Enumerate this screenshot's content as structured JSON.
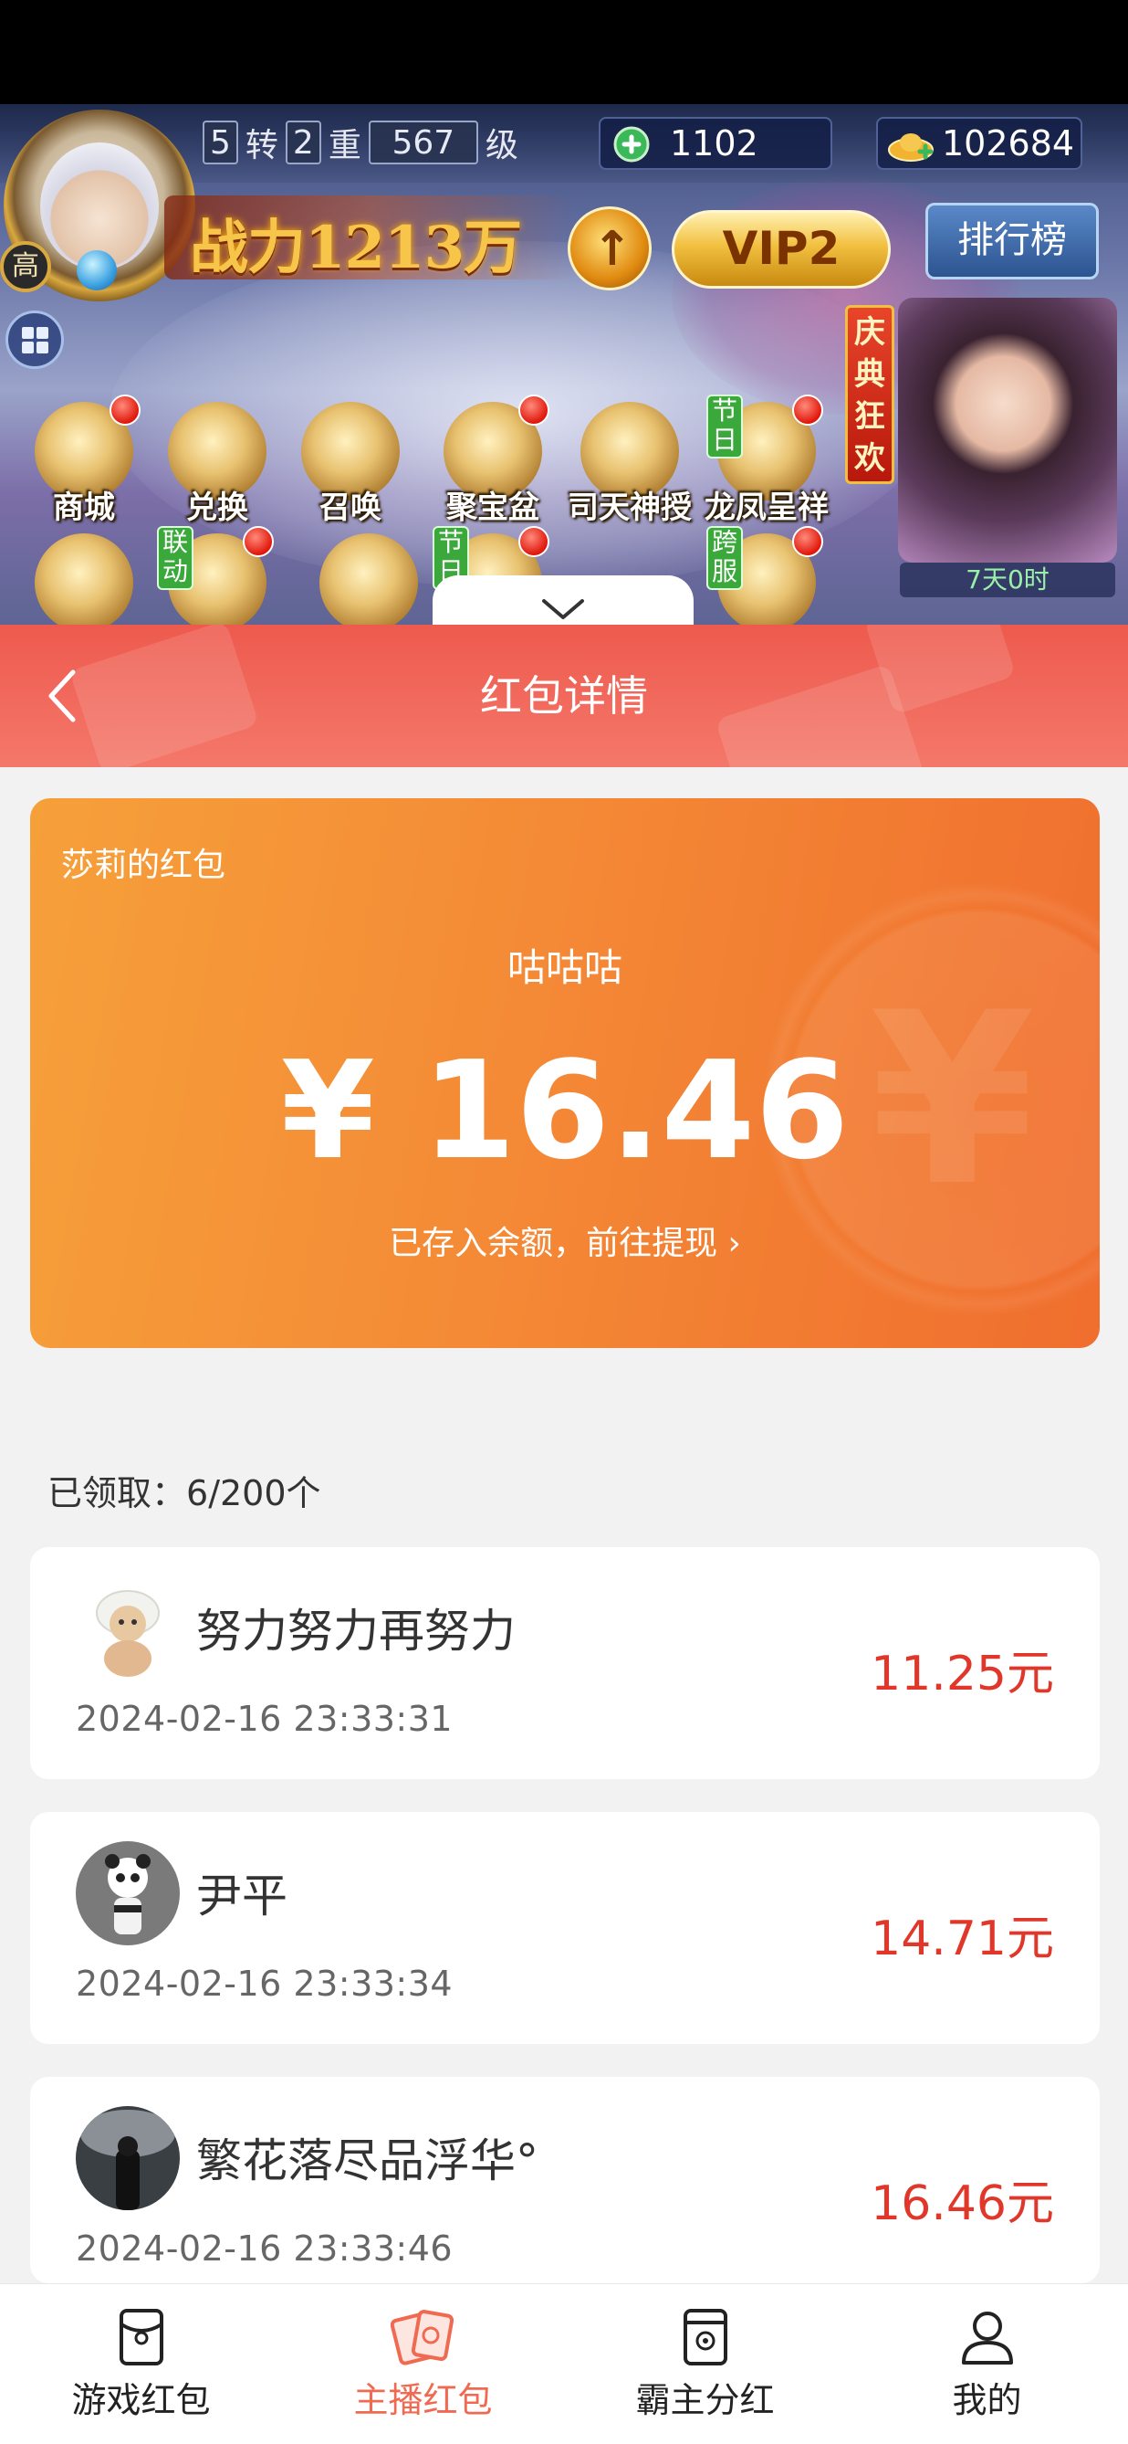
{
  "game": {
    "rank_badge": "高",
    "level": {
      "zhuan_num": "5",
      "zhuan_label": "转",
      "chong_num": "2",
      "chong_label": "重",
      "level_num": "567",
      "level_label": "级"
    },
    "jade": "1102",
    "gold": "102684",
    "power": "战力1213万",
    "vip": "VIP2",
    "ranking_label": "排行榜",
    "festival": {
      "banner": "庆典狂欢",
      "timer": "7天0时"
    },
    "icons": [
      {
        "label": "商城",
        "dot": true,
        "tag": ""
      },
      {
        "label": "兑换",
        "dot": false,
        "tag": ""
      },
      {
        "label": "召唤",
        "dot": false,
        "tag": ""
      },
      {
        "label": "聚宝盆",
        "dot": true,
        "tag": ""
      },
      {
        "label": "司天神授",
        "dot": false,
        "tag": ""
      },
      {
        "label": "龙凤呈祥",
        "dot": true,
        "tag": "节日"
      }
    ],
    "row2_tags": [
      "联动",
      "节日",
      "跨服"
    ]
  },
  "header": {
    "title": "红包详情"
  },
  "packet": {
    "owner": "莎莉的红包",
    "message": "咕咕咕",
    "amount": "¥ 16.46",
    "hint": "已存入余额，前往提现 ›"
  },
  "received": {
    "label": "已领取：",
    "count": "6/200个"
  },
  "records": [
    {
      "name": "努力努力再努力",
      "time": "2024-02-16 23:33:31",
      "amount": "11.25元"
    },
    {
      "name": "尹平",
      "time": "2024-02-16 23:33:34",
      "amount": "14.71元"
    },
    {
      "name": "繁花落尽品浮华°",
      "time": "2024-02-16 23:33:46",
      "amount": "16.46元"
    }
  ],
  "nav": [
    {
      "label": "游戏红包",
      "icon": "red-packet-icon"
    },
    {
      "label": "主播红包",
      "icon": "cards-icon"
    },
    {
      "label": "霸主分红",
      "icon": "card-icon"
    },
    {
      "label": "我的",
      "icon": "user-icon"
    }
  ],
  "colors": {
    "accent": "#f06a52",
    "header": "#ee5a4e",
    "amount": "#e0372a",
    "card_start": "#f6a03a",
    "card_end": "#f06e2e"
  }
}
